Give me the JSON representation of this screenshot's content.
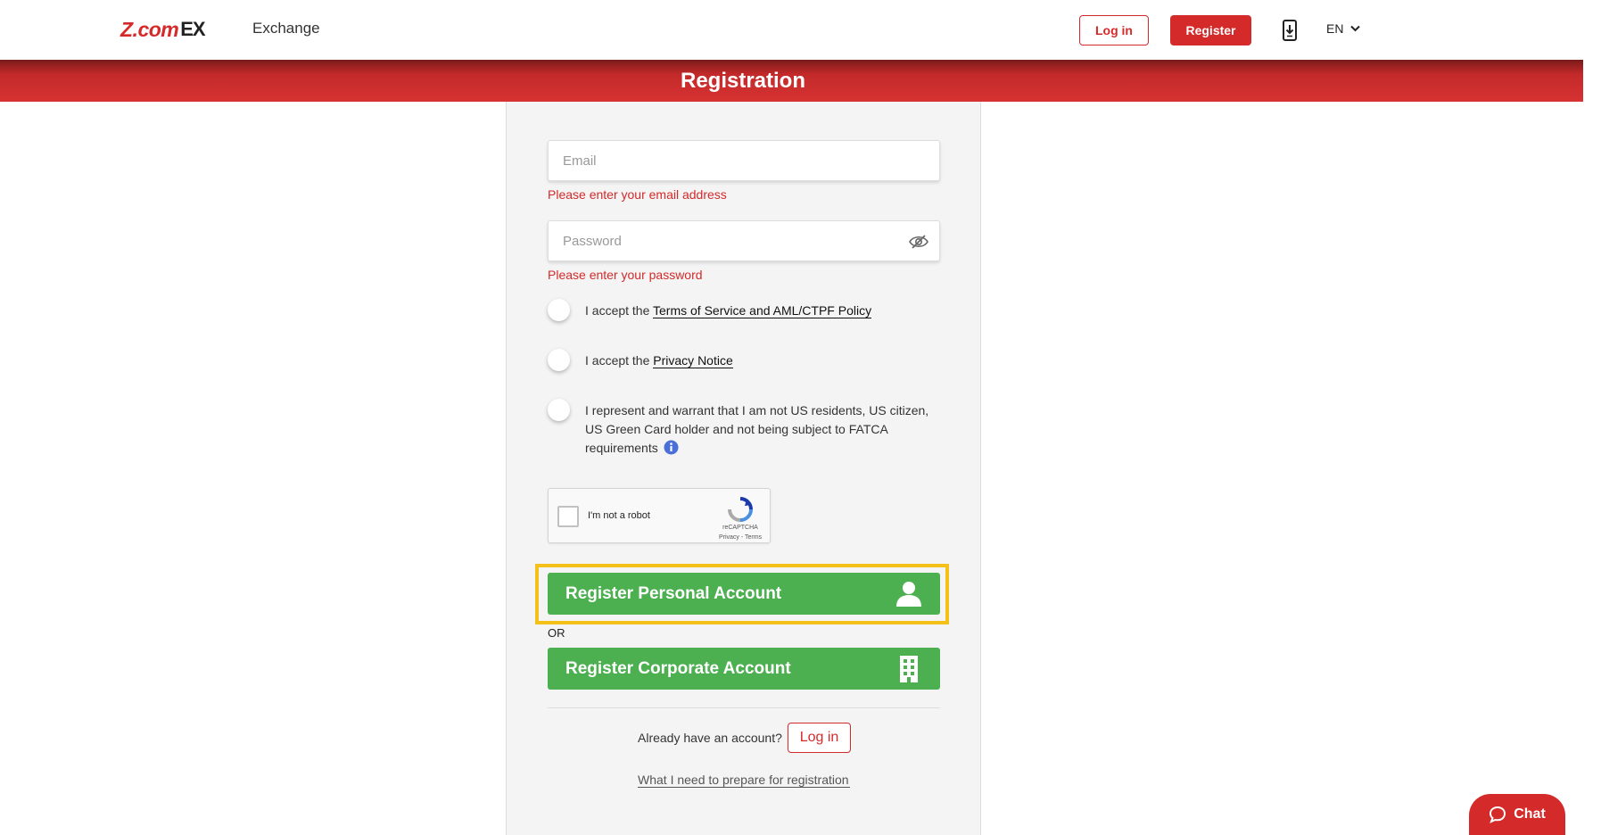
{
  "header": {
    "logo_text": "Z.com",
    "logo_suffix": "EX",
    "exchange_label": "Exchange",
    "login_label": "Log in",
    "register_label": "Register",
    "language": "EN"
  },
  "banner": {
    "title": "Registration"
  },
  "form": {
    "email": {
      "placeholder": "Email",
      "value": "",
      "error": "Please enter your email address"
    },
    "password": {
      "placeholder": "Password",
      "value": "",
      "error": "Please enter your password"
    },
    "terms": {
      "prefix": "I accept the ",
      "link": "Terms of Service and AML/CTPF Policy"
    },
    "privacy": {
      "prefix": "I accept the ",
      "link": "Privacy Notice"
    },
    "us_warranty": {
      "text": "I represent and warrant that I am not US residents, US citizen, US Green Card holder and not being subject to FATCA requirements"
    },
    "captcha": {
      "label": "I'm not a robot",
      "brand": "reCAPTCHA",
      "links": "Privacy - Terms"
    },
    "personal_button": "Register Personal Account",
    "or_label": "OR",
    "corporate_button": "Register Corporate Account",
    "already_text": "Already have an account?",
    "login_label": "Log in",
    "prepare_link": "What I need to prepare for registration"
  },
  "chat": {
    "label": "Chat"
  },
  "colors": {
    "brand_red": "#d42a2a",
    "green": "#4caf50",
    "highlight": "#f4c11a"
  }
}
